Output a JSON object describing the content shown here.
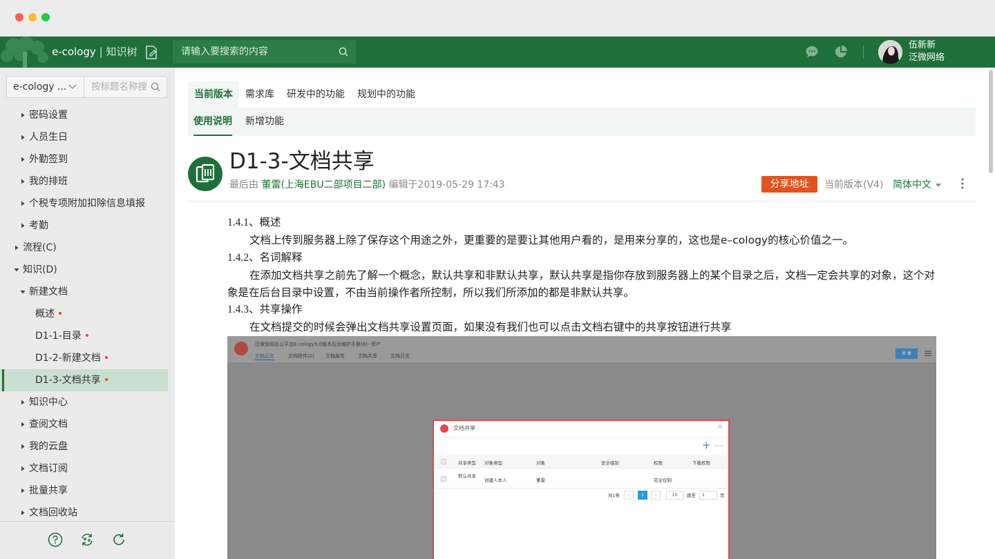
{
  "app": {
    "brand": "e-cology",
    "separator": "|",
    "module": "知识树",
    "search_placeholder": "请输入要搜索的内容",
    "user_name": "伍新新",
    "user_org": "泛微网络",
    "colors": {
      "header": "#1f6f3a",
      "accent": "#1f6f3a",
      "share": "#e2531f"
    }
  },
  "sidebar": {
    "select_value": "e-cology ...",
    "search_placeholder": "按标题名称搜",
    "items": [
      {
        "label": "密码设置",
        "expanded": false,
        "level": 1
      },
      {
        "label": "人员生日",
        "expanded": false,
        "level": 1
      },
      {
        "label": "外勤签到",
        "expanded": false,
        "level": 1
      },
      {
        "label": "我的排班",
        "expanded": false,
        "level": 1
      },
      {
        "label": "个税专项附加扣除信息填报",
        "expanded": false,
        "level": 1
      },
      {
        "label": "考勤",
        "expanded": false,
        "level": 1
      },
      {
        "label": "流程(C)",
        "expanded": false,
        "level": 0
      },
      {
        "label": "知识(D)",
        "expanded": true,
        "level": 0
      },
      {
        "label": "新建文档",
        "expanded": true,
        "level": 1
      },
      {
        "label": "概述",
        "level": 2,
        "new": true
      },
      {
        "label": "D1-1-目录",
        "level": 2,
        "new": true
      },
      {
        "label": "D1-2-新建文档",
        "level": 2,
        "new": true
      },
      {
        "label": "D1-3-文档共享",
        "level": 2,
        "new": true,
        "selected": true
      },
      {
        "label": "知识中心",
        "expanded": false,
        "level": 1
      },
      {
        "label": "查阅文档",
        "expanded": false,
        "level": 1
      },
      {
        "label": "我的云盘",
        "expanded": false,
        "level": 1
      },
      {
        "label": "文档订阅",
        "expanded": false,
        "level": 1
      },
      {
        "label": "批量共享",
        "expanded": false,
        "level": 1
      },
      {
        "label": "文档回收站",
        "expanded": false,
        "level": 1
      }
    ],
    "footer_icons": [
      "help-icon",
      "sync-icon",
      "refresh-icon"
    ]
  },
  "tabs": {
    "primary": [
      "当前版本",
      "需求库",
      "研发中的功能",
      "规划中的功能"
    ],
    "secondary": [
      "使用说明",
      "新增功能"
    ]
  },
  "doc": {
    "title": "D1-3-文档共享",
    "meta_prefix": "最后由",
    "author": "董雷(上海EBU二部项目二部)",
    "meta_suffix": "编辑于2019-05-29 17:43",
    "share_label": "分享地址",
    "version_label": "当前版本(V4)",
    "language": "简体中文",
    "sections": [
      {
        "heading": "1.4.1、概述",
        "text": "文档上传到服务器上除了保存这个用途之外，更重要的是要让其他用户看的，是用来分享的，这也是e–cology的核心价值之一。"
      },
      {
        "heading": "1.4.2、名词解释",
        "text": "在添加文档共享之前先了解一个概念，默认共享和非默认共享，默认共享是指你存放到服务器上的某个目录之后，文档一定会共享的对象，这个对象是在后台目录中设置，不由当前操作者所控制，所以我们所添加的都是非默认共享。"
      },
      {
        "heading": "1.4.3、共享操作",
        "text": "在文档提交的时候会弹出文档共享设置页面，如果没有我们也可以点击文档右键中的共享按钮进行共享"
      }
    ]
  },
  "screenshot": {
    "title": "泛微协同办公平台E-cology9.0版本后台维护手册(6)--资产",
    "tabs": [
      "文档正文",
      "文档附件(0)",
      "文档属性",
      "文档共享",
      "文档日志"
    ],
    "button": "共 享",
    "dialog": {
      "title": "文档共享",
      "headers": [
        "共享类型",
        "对象类型",
        "对象",
        "安全级别",
        "权限",
        "下载权限"
      ],
      "row": [
        "默认共享",
        "创建人本人",
        "董雷",
        "",
        "完全控制",
        ""
      ],
      "pager": {
        "total": "共1条",
        "page": "1",
        "size": "10",
        "goto": "跳至",
        "goto_value": "1",
        "page_suffix": "页"
      }
    }
  }
}
